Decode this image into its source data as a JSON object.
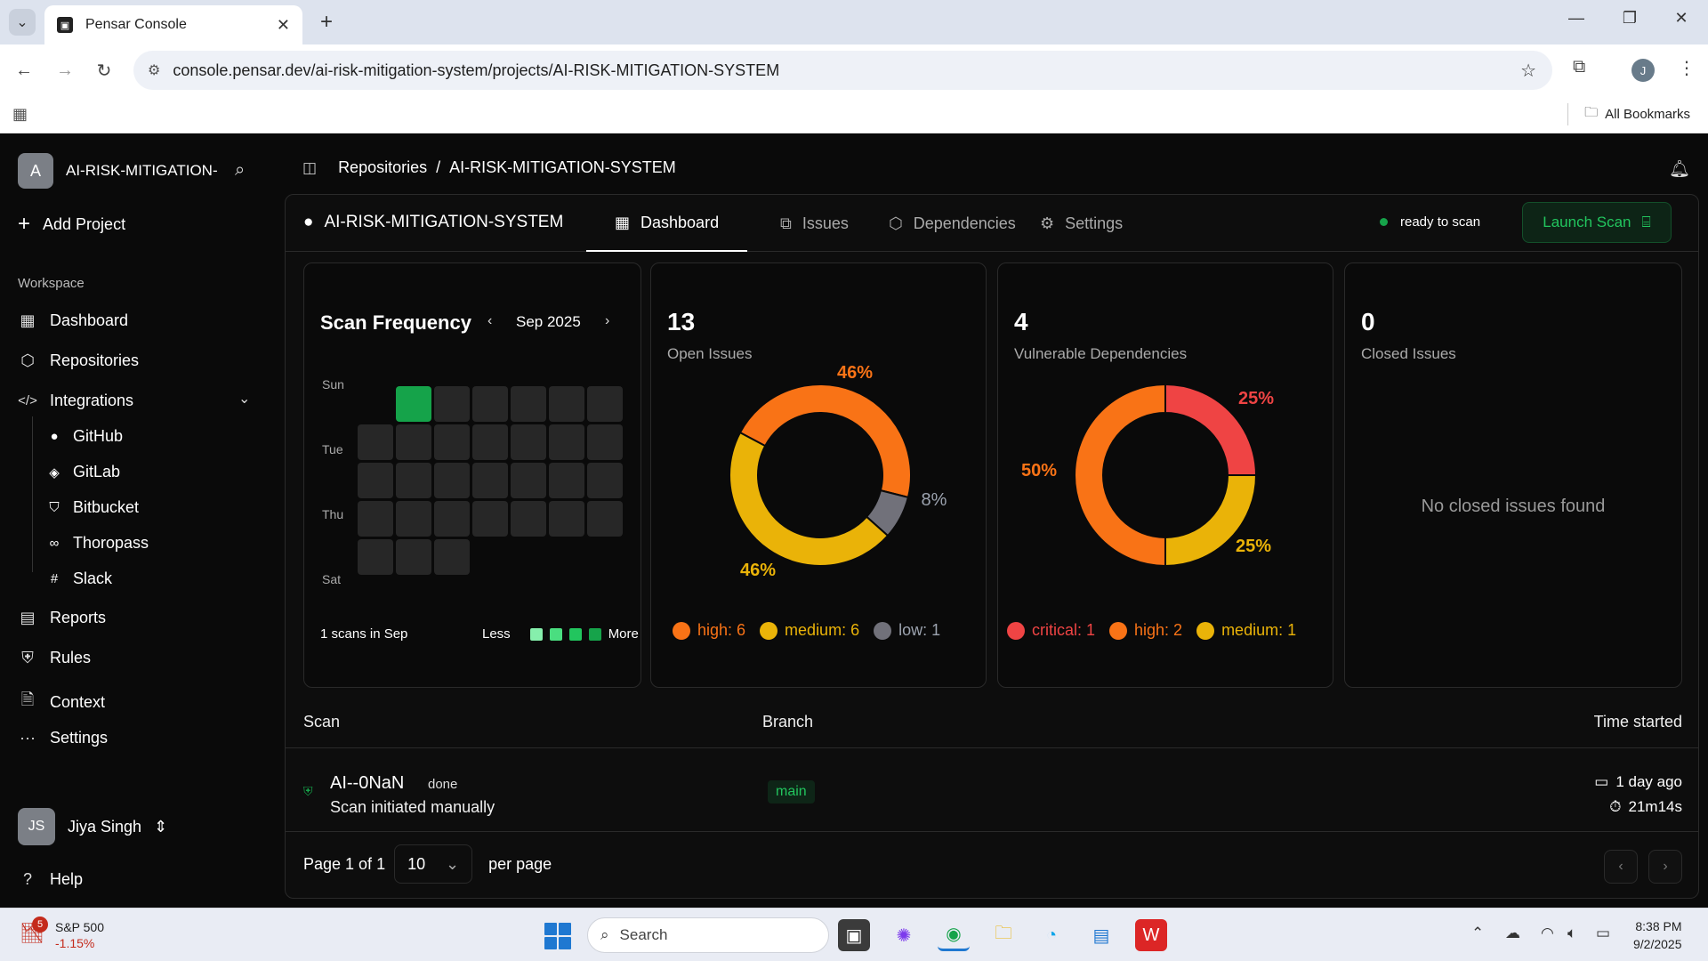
{
  "browser": {
    "tab_title": "Pensar Console",
    "url": "console.pensar.dev/ai-risk-mitigation-system/projects/AI-RISK-MITIGATION-SYSTEM",
    "all_bookmarks": "All Bookmarks",
    "profile_initial": "J"
  },
  "sidebar": {
    "project_initial": "A",
    "project_name": "AI-RISK-MITIGATION-",
    "add_project": "Add Project",
    "workspace_label": "Workspace",
    "items": [
      {
        "label": "Dashboard",
        "icon": "dashboard-icon"
      },
      {
        "label": "Repositories",
        "icon": "box-icon"
      },
      {
        "label": "Integrations",
        "icon": "code-icon"
      }
    ],
    "integrations": [
      {
        "label": "GitHub",
        "icon": "github-icon"
      },
      {
        "label": "GitLab",
        "icon": "gitlab-icon"
      },
      {
        "label": "Bitbucket",
        "icon": "bitbucket-icon"
      },
      {
        "label": "Thoropass",
        "icon": "thoropass-icon"
      },
      {
        "label": "Slack",
        "icon": "slack-icon"
      }
    ],
    "lower_items": [
      {
        "label": "Reports",
        "icon": "document-icon"
      },
      {
        "label": "Rules",
        "icon": "shield-icon"
      },
      {
        "label": "Context",
        "icon": "file-icon"
      },
      {
        "label": "Settings",
        "icon": "more-icon"
      }
    ],
    "user_initials": "JS",
    "user_name": "Jiya Singh",
    "help": "Help"
  },
  "breadcrumb": {
    "root": "Repositories",
    "sep": "/",
    "current": "AI-RISK-MITIGATION-SYSTEM"
  },
  "panel": {
    "repo_name": "AI-RISK-MITIGATION-SYSTEM",
    "tabs": [
      {
        "label": "Dashboard",
        "icon": "dashboard-icon",
        "active": true
      },
      {
        "label": "Issues",
        "icon": "issues-icon",
        "active": false
      },
      {
        "label": "Dependencies",
        "icon": "package-icon",
        "active": false
      },
      {
        "label": "Settings",
        "icon": "gear-icon",
        "active": false
      }
    ],
    "status": "ready to scan",
    "launch": "Launch Scan"
  },
  "scan_frequency": {
    "title": "Scan Frequency",
    "month": "Sep 2025",
    "day_labels": [
      "Sun",
      "Tue",
      "Thu",
      "Sat"
    ],
    "footer": "1 scans in Sep",
    "less": "Less",
    "more": "More",
    "active_day": 1
  },
  "open_issues": {
    "count": "13",
    "label": "Open Issues",
    "pct_high": "46%",
    "pct_low": "8%",
    "pct_medium": "46%",
    "legend": [
      {
        "label": "high: 6",
        "color": "#f97316"
      },
      {
        "label": "medium: 6",
        "color": "#eab308"
      },
      {
        "label": "low: 1",
        "color": "#71717a"
      }
    ]
  },
  "vuln_deps": {
    "count": "4",
    "label": "Vulnerable Dependencies",
    "pct_critical": "25%",
    "pct_medium": "25%",
    "pct_high": "50%",
    "legend": [
      {
        "label": "critical: 1",
        "color": "#ef4444"
      },
      {
        "label": "high: 2",
        "color": "#f97316"
      },
      {
        "label": "medium: 1",
        "color": "#eab308"
      }
    ]
  },
  "closed_issues": {
    "count": "0",
    "label": "Closed Issues",
    "empty": "No closed issues found"
  },
  "table": {
    "headers": {
      "scan": "Scan",
      "branch": "Branch",
      "time": "Time started"
    },
    "rows": [
      {
        "name": "AI--0NaN",
        "status": "done",
        "desc": "Scan initiated manually",
        "branch": "main",
        "time": "1 day ago",
        "duration": "21m14s"
      }
    ],
    "page_text": "Page 1 of 1",
    "per_page_value": "10",
    "per_page_label": "per page"
  },
  "taskbar": {
    "stock_name": "S&P 500",
    "stock_change": "-1.15%",
    "badge": "5",
    "search": "Search",
    "time": "8:38 PM",
    "date": "9/2/2025"
  }
}
